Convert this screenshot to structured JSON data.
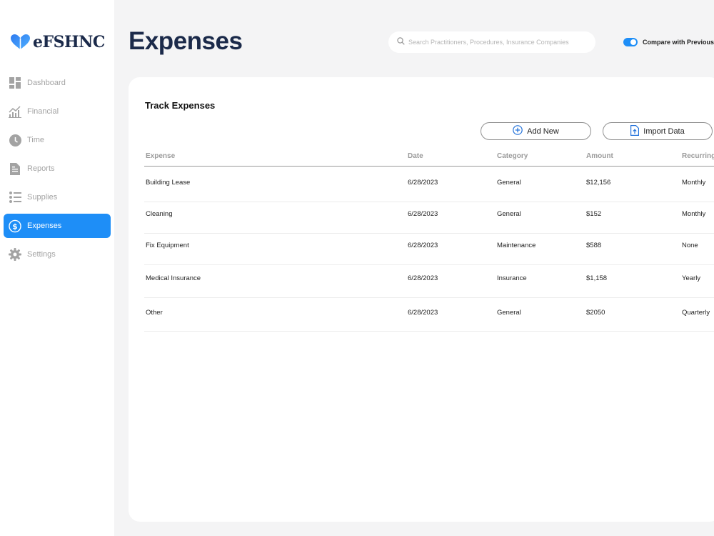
{
  "app": {
    "logo_text": "eFSHNC"
  },
  "sidebar": {
    "items": [
      {
        "label": "Dashboard",
        "icon": "dashboard-icon"
      },
      {
        "label": "Financial",
        "icon": "chart-icon"
      },
      {
        "label": "Time",
        "icon": "clock-icon"
      },
      {
        "label": "Reports",
        "icon": "document-icon"
      },
      {
        "label": "Supplies",
        "icon": "list-icon"
      },
      {
        "label": "Expenses",
        "icon": "dollar-icon",
        "active": true
      },
      {
        "label": "Settings",
        "icon": "gear-icon"
      }
    ]
  },
  "header": {
    "title": "Expenses",
    "search_placeholder": "Search Practitioners, Procedures, Insurance Companies",
    "compare_label": "Compare with Previous",
    "compare_enabled": true
  },
  "card": {
    "title": "Track Expenses",
    "add_label": "Add New",
    "import_label": "Import Data"
  },
  "table": {
    "headers": [
      "Expense",
      "Date",
      "Category",
      "Amount",
      "Recurring"
    ],
    "rows": [
      [
        "Building Lease",
        "6/28/2023",
        "General",
        "$12,156",
        "Monthly"
      ],
      [
        "Cleaning",
        "6/28/2023",
        "General",
        "$152",
        "Monthly"
      ],
      [
        "Fix Equipment",
        "6/28/2023",
        "Maintenance",
        "$588",
        "None"
      ],
      [
        "Medical Insurance",
        "6/28/2023",
        "Insurance",
        "$1,158",
        "Yearly"
      ],
      [
        "Other",
        "6/28/2023",
        "General",
        "$2050",
        "Quarterly"
      ]
    ]
  },
  "colors": {
    "accent": "#1e8ef7",
    "title": "#1b2a4a",
    "muted": "#a3a3a3",
    "background": "#f4f4f5"
  }
}
